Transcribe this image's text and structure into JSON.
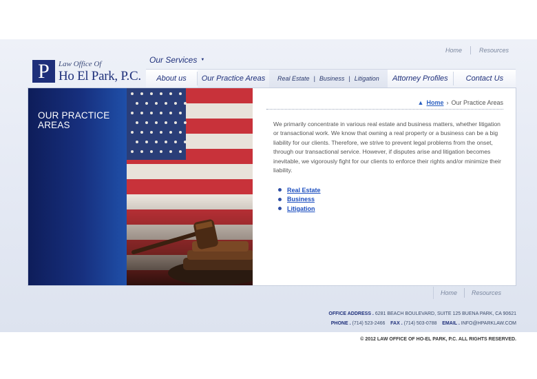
{
  "logo": {
    "letter": "P",
    "small": "Law Office Of",
    "big": "Ho El Park, P.C."
  },
  "toplinks": {
    "home": "Home",
    "resources": "Resources"
  },
  "services": {
    "label": "Our Services"
  },
  "nav": {
    "about": "About us",
    "practice": "Our Practice Areas",
    "sub": [
      "Real Estate",
      "Business",
      "Litigation"
    ],
    "attorney": "Attorney Profiles",
    "contact": "Contact Us"
  },
  "hero": {
    "title_line1": "OUR PRACTICE",
    "title_line2": "AREAS"
  },
  "breadcrumb": {
    "home": "Home",
    "current": "Our Practice Areas"
  },
  "content": {
    "paragraph": "We primarily concentrate in various real estate and business matters, whether litigation or transactional work. We know that owning a real property or a business can be a big liability for our clients. Therefore, we strive to prevent legal problems from the onset, through our transactional service. However, if disputes arise and litigation becomes inevitable, we vigorously fight for our clients to enforce their rights and/or minimize their liability.",
    "links": [
      "Real Estate",
      "Business",
      "Litigation"
    ]
  },
  "bottomlinks": {
    "home": "Home",
    "resources": "Resources"
  },
  "footer": {
    "address_label": "OFFICE ADDRESS .",
    "address": "6281 BEACH BOULEVARD, SUITE 125 BUENA PARK, CA 90621",
    "phone_label": "PHONE .",
    "phone": "(714) 523-2466",
    "fax_label": "FAX .",
    "fax": "(714) 503-0788",
    "email_label": "EMAIL .",
    "email": "INFO@HPARKLAW.COM",
    "copyright": "© 2012 LAW OFFICE OF HO-EL PARK, P.C. ALL RIGHTS RESERVED."
  }
}
